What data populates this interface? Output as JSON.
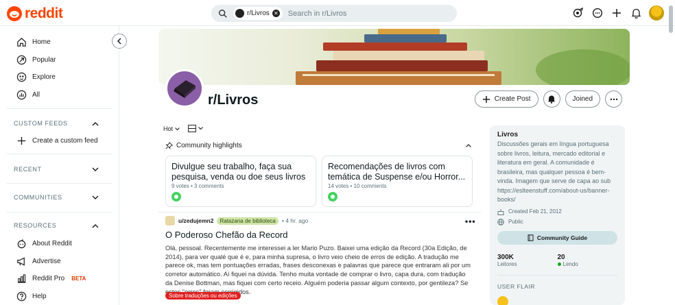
{
  "header": {
    "logo_text": "reddit",
    "search": {
      "chip_label": "r/Livros",
      "placeholder": "Search in r/Livros"
    }
  },
  "sidebar": {
    "main": [
      {
        "label": "Home",
        "icon": "home-icon"
      },
      {
        "label": "Popular",
        "icon": "popular-icon"
      },
      {
        "label": "Explore",
        "icon": "explore-icon"
      },
      {
        "label": "All",
        "icon": "all-icon"
      }
    ],
    "custom_feeds_title": "CUSTOM FEEDS",
    "create_feed_label": "Create a custom feed",
    "recent_title": "RECENT",
    "communities_title": "COMMUNITIES",
    "resources_title": "RESOURCES",
    "resources": [
      {
        "label": "About Reddit",
        "icon": "about-icon"
      },
      {
        "label": "Advertise",
        "icon": "advertise-icon"
      },
      {
        "label": "Reddit Pro",
        "icon": "reddit-pro-icon",
        "badge": "BETA"
      },
      {
        "label": "Help",
        "icon": "help-icon"
      }
    ]
  },
  "subreddit": {
    "name": "r/Livros",
    "create_post_label": "Create Post",
    "joined_label": "Joined"
  },
  "feed": {
    "sort_label": "Hot",
    "highlights_title": "Community highlights",
    "highlights": [
      {
        "title": "Divulgue seu trabalho, faça sua pesquisa, venda ou doe seus livros",
        "votes": "9 votes",
        "comments": "3 comments"
      },
      {
        "title": "Recomendações de livros com temática de Suspense e/ou Horror...",
        "votes": "14 votes",
        "comments": "10 comments"
      }
    ],
    "post": {
      "author": "u/zedujemn2",
      "flair": "Ratazana de biblioteca",
      "time": "4 hr. ago",
      "title": "O Poderoso Chefão da Record",
      "body": "Olá, pessoal. Recentemente me interessei a ler Mario Puzo. Baixei uma edição da Record (30a Edição, de 2014), para ver qualé que é e, para minha supresa, o livro veio cheio de erros de edição. A tradução me parece ok, mas tem pontuações erradas, frases desconexas e palavras que parece que entraram ali por um corretor automático. Aí fiquei na dúvida. Tenho muita vontade de comprar o livro, capa dura, com tradução da Denise Bottman, mas fiquei com certo receio. Alguém poderia passar algum contexto, por gentileza? Se estes \"erros\" foram corrigidos.",
      "post_flair": "Sobre traduções ou edições"
    }
  },
  "about": {
    "title": "Livros",
    "description": "Discussões gerais em língua portuguesa sobre livros, leitura, mercado editorial e literatura em geral. A comunidade é brasileira, mas qualquer pessoa é bem-vinda. Imagem que serve de capa ao sub https://eslteenstuff.com/about-us/banner-books/",
    "created": "Created Feb 21, 2012",
    "visibility": "Public",
    "guide_label": "Community Guide",
    "members_value": "300K",
    "members_label": "Leitores",
    "online_value": "20",
    "online_label": "Lendo",
    "user_flair_title": "USER FLAIR"
  },
  "colors": {
    "brand": "#ff4500",
    "online": "#01a816",
    "post_flair_bg": "#e02020",
    "user_flair_bg": "#cde5a6"
  }
}
